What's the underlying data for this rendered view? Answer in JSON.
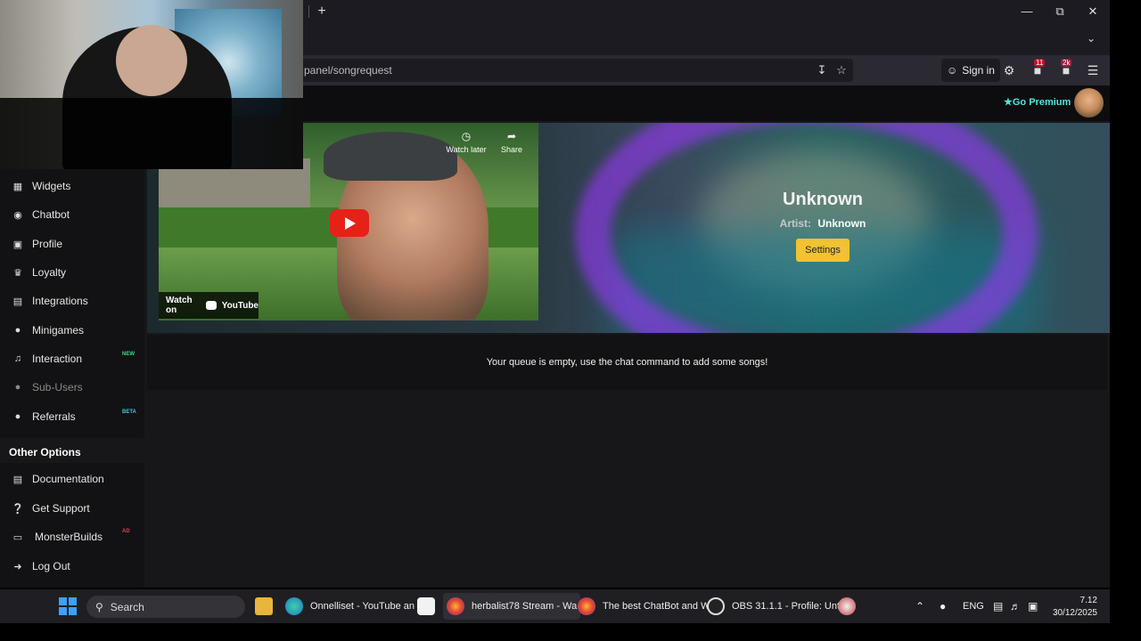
{
  "browser": {
    "url": "panel/songrequest",
    "sign_in": "Sign in",
    "ext_badge_count": "11",
    "ext_badge_2k": "2k"
  },
  "header": {
    "premium_label": "Go Premium"
  },
  "video": {
    "watch_later": "Watch later",
    "share": "Share",
    "watch_on": "Watch on",
    "youtube": "YouTube"
  },
  "now_playing": {
    "title": "Unknown",
    "artist_label": "Artist:",
    "artist_value": "Unknown",
    "settings_label": "Settings"
  },
  "queue": {
    "empty_message": "Your queue is empty, use the chat command to add some songs!"
  },
  "sidebar": {
    "items": [
      {
        "label": "Widgets",
        "icon": "grid-icon"
      },
      {
        "label": "Chatbot",
        "icon": "robot-icon"
      },
      {
        "label": "Profile",
        "icon": "id-card-icon"
      },
      {
        "label": "Loyalty",
        "icon": "trophy-icon"
      },
      {
        "label": "Integrations",
        "icon": "plug-icon"
      },
      {
        "label": "Minigames",
        "icon": "gamepad-icon"
      },
      {
        "label": "Interaction",
        "icon": "music-icon",
        "tag": "NEW",
        "tag_color": "#39d98a"
      },
      {
        "label": "Sub-Users",
        "icon": "users-icon",
        "disabled": true
      },
      {
        "label": "Referrals",
        "icon": "user-group-icon",
        "tag": "BETA",
        "tag_color": "#3cc8d8"
      }
    ],
    "other_title": "Other Options",
    "other_items": [
      {
        "label": "Documentation",
        "icon": "book-icon"
      },
      {
        "label": "Get Support",
        "icon": "question-icon"
      },
      {
        "label": "MonsterBuilds",
        "icon": "laptop-icon",
        "tag": "AD",
        "tag_color": "#e0405a"
      },
      {
        "label": "Log Out",
        "icon": "logout-icon"
      }
    ]
  },
  "taskbar": {
    "search": "Search",
    "apps": [
      {
        "label": "Onnelliset - YouTube an",
        "icon": "edge-icon"
      },
      {
        "label": "herbalist78 Stream - Wa",
        "icon": "firefox-icon",
        "active": true
      },
      {
        "label": "The best ChatBot and W",
        "icon": "firefox-icon"
      },
      {
        "label": "OBS 31.1.1 - Profile: Unti",
        "icon": "obs-icon"
      }
    ],
    "lang": "ENG",
    "time": "7.12",
    "date": "30/12/2025"
  },
  "colors": {
    "accent_premium": "#4ee6e0",
    "settings_button": "#f1c232",
    "youtube_red": "#e62117"
  }
}
